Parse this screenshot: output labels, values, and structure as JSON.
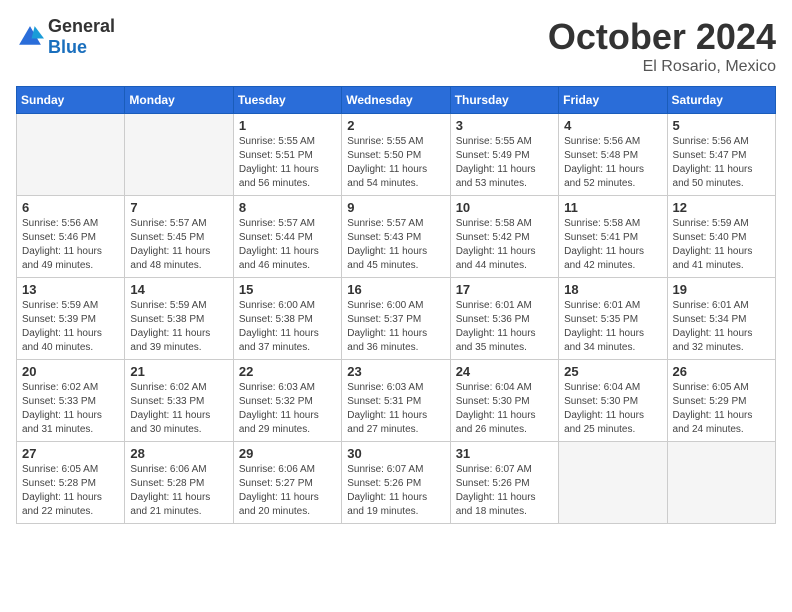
{
  "header": {
    "logo_general": "General",
    "logo_blue": "Blue",
    "month": "October 2024",
    "location": "El Rosario, Mexico"
  },
  "weekdays": [
    "Sunday",
    "Monday",
    "Tuesday",
    "Wednesday",
    "Thursday",
    "Friday",
    "Saturday"
  ],
  "weeks": [
    [
      {
        "day": "",
        "empty": true
      },
      {
        "day": "",
        "empty": true
      },
      {
        "day": "1",
        "sunrise": "Sunrise: 5:55 AM",
        "sunset": "Sunset: 5:51 PM",
        "daylight": "Daylight: 11 hours and 56 minutes."
      },
      {
        "day": "2",
        "sunrise": "Sunrise: 5:55 AM",
        "sunset": "Sunset: 5:50 PM",
        "daylight": "Daylight: 11 hours and 54 minutes."
      },
      {
        "day": "3",
        "sunrise": "Sunrise: 5:55 AM",
        "sunset": "Sunset: 5:49 PM",
        "daylight": "Daylight: 11 hours and 53 minutes."
      },
      {
        "day": "4",
        "sunrise": "Sunrise: 5:56 AM",
        "sunset": "Sunset: 5:48 PM",
        "daylight": "Daylight: 11 hours and 52 minutes."
      },
      {
        "day": "5",
        "sunrise": "Sunrise: 5:56 AM",
        "sunset": "Sunset: 5:47 PM",
        "daylight": "Daylight: 11 hours and 50 minutes."
      }
    ],
    [
      {
        "day": "6",
        "sunrise": "Sunrise: 5:56 AM",
        "sunset": "Sunset: 5:46 PM",
        "daylight": "Daylight: 11 hours and 49 minutes."
      },
      {
        "day": "7",
        "sunrise": "Sunrise: 5:57 AM",
        "sunset": "Sunset: 5:45 PM",
        "daylight": "Daylight: 11 hours and 48 minutes."
      },
      {
        "day": "8",
        "sunrise": "Sunrise: 5:57 AM",
        "sunset": "Sunset: 5:44 PM",
        "daylight": "Daylight: 11 hours and 46 minutes."
      },
      {
        "day": "9",
        "sunrise": "Sunrise: 5:57 AM",
        "sunset": "Sunset: 5:43 PM",
        "daylight": "Daylight: 11 hours and 45 minutes."
      },
      {
        "day": "10",
        "sunrise": "Sunrise: 5:58 AM",
        "sunset": "Sunset: 5:42 PM",
        "daylight": "Daylight: 11 hours and 44 minutes."
      },
      {
        "day": "11",
        "sunrise": "Sunrise: 5:58 AM",
        "sunset": "Sunset: 5:41 PM",
        "daylight": "Daylight: 11 hours and 42 minutes."
      },
      {
        "day": "12",
        "sunrise": "Sunrise: 5:59 AM",
        "sunset": "Sunset: 5:40 PM",
        "daylight": "Daylight: 11 hours and 41 minutes."
      }
    ],
    [
      {
        "day": "13",
        "sunrise": "Sunrise: 5:59 AM",
        "sunset": "Sunset: 5:39 PM",
        "daylight": "Daylight: 11 hours and 40 minutes."
      },
      {
        "day": "14",
        "sunrise": "Sunrise: 5:59 AM",
        "sunset": "Sunset: 5:38 PM",
        "daylight": "Daylight: 11 hours and 39 minutes."
      },
      {
        "day": "15",
        "sunrise": "Sunrise: 6:00 AM",
        "sunset": "Sunset: 5:38 PM",
        "daylight": "Daylight: 11 hours and 37 minutes."
      },
      {
        "day": "16",
        "sunrise": "Sunrise: 6:00 AM",
        "sunset": "Sunset: 5:37 PM",
        "daylight": "Daylight: 11 hours and 36 minutes."
      },
      {
        "day": "17",
        "sunrise": "Sunrise: 6:01 AM",
        "sunset": "Sunset: 5:36 PM",
        "daylight": "Daylight: 11 hours and 35 minutes."
      },
      {
        "day": "18",
        "sunrise": "Sunrise: 6:01 AM",
        "sunset": "Sunset: 5:35 PM",
        "daylight": "Daylight: 11 hours and 34 minutes."
      },
      {
        "day": "19",
        "sunrise": "Sunrise: 6:01 AM",
        "sunset": "Sunset: 5:34 PM",
        "daylight": "Daylight: 11 hours and 32 minutes."
      }
    ],
    [
      {
        "day": "20",
        "sunrise": "Sunrise: 6:02 AM",
        "sunset": "Sunset: 5:33 PM",
        "daylight": "Daylight: 11 hours and 31 minutes."
      },
      {
        "day": "21",
        "sunrise": "Sunrise: 6:02 AM",
        "sunset": "Sunset: 5:33 PM",
        "daylight": "Daylight: 11 hours and 30 minutes."
      },
      {
        "day": "22",
        "sunrise": "Sunrise: 6:03 AM",
        "sunset": "Sunset: 5:32 PM",
        "daylight": "Daylight: 11 hours and 29 minutes."
      },
      {
        "day": "23",
        "sunrise": "Sunrise: 6:03 AM",
        "sunset": "Sunset: 5:31 PM",
        "daylight": "Daylight: 11 hours and 27 minutes."
      },
      {
        "day": "24",
        "sunrise": "Sunrise: 6:04 AM",
        "sunset": "Sunset: 5:30 PM",
        "daylight": "Daylight: 11 hours and 26 minutes."
      },
      {
        "day": "25",
        "sunrise": "Sunrise: 6:04 AM",
        "sunset": "Sunset: 5:30 PM",
        "daylight": "Daylight: 11 hours and 25 minutes."
      },
      {
        "day": "26",
        "sunrise": "Sunrise: 6:05 AM",
        "sunset": "Sunset: 5:29 PM",
        "daylight": "Daylight: 11 hours and 24 minutes."
      }
    ],
    [
      {
        "day": "27",
        "sunrise": "Sunrise: 6:05 AM",
        "sunset": "Sunset: 5:28 PM",
        "daylight": "Daylight: 11 hours and 22 minutes."
      },
      {
        "day": "28",
        "sunrise": "Sunrise: 6:06 AM",
        "sunset": "Sunset: 5:28 PM",
        "daylight": "Daylight: 11 hours and 21 minutes."
      },
      {
        "day": "29",
        "sunrise": "Sunrise: 6:06 AM",
        "sunset": "Sunset: 5:27 PM",
        "daylight": "Daylight: 11 hours and 20 minutes."
      },
      {
        "day": "30",
        "sunrise": "Sunrise: 6:07 AM",
        "sunset": "Sunset: 5:26 PM",
        "daylight": "Daylight: 11 hours and 19 minutes."
      },
      {
        "day": "31",
        "sunrise": "Sunrise: 6:07 AM",
        "sunset": "Sunset: 5:26 PM",
        "daylight": "Daylight: 11 hours and 18 minutes."
      },
      {
        "day": "",
        "empty": true
      },
      {
        "day": "",
        "empty": true
      }
    ]
  ]
}
